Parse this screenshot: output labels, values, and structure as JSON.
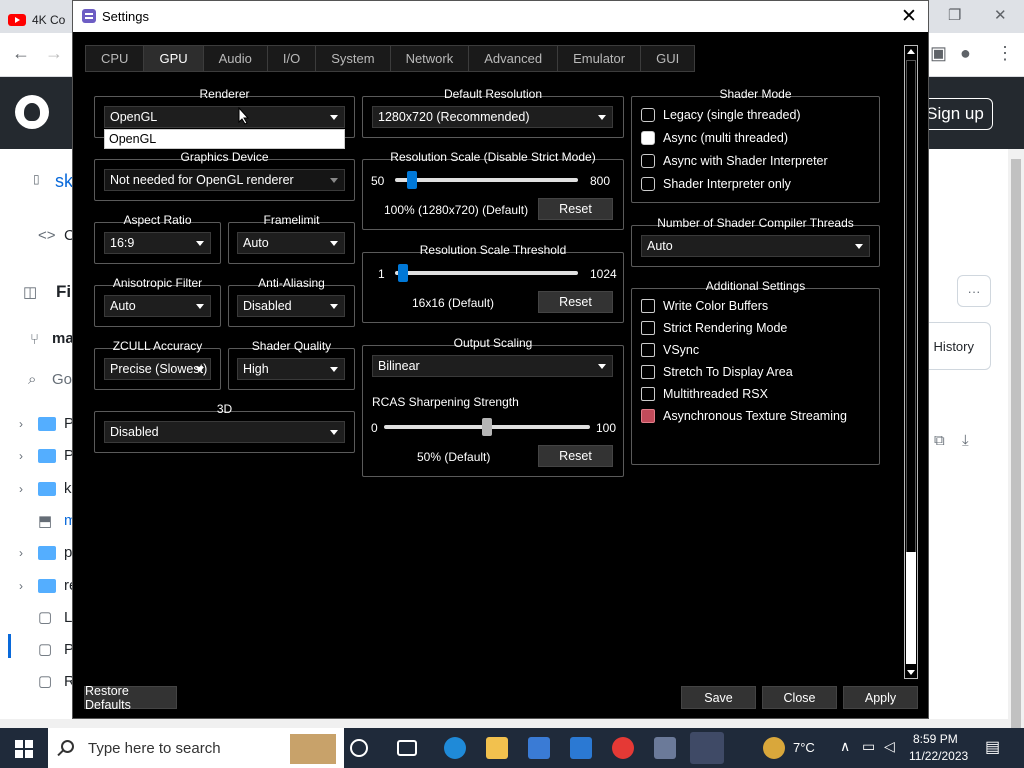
{
  "browser": {
    "tab_title": "4K Co",
    "signup": "Sign up",
    "repo_short": "sk",
    "code_tab": "C",
    "files_label": "Fil",
    "branch": "ma",
    "goto": "Go",
    "history": "History",
    "list_items": [
      "P",
      "P",
      "k",
      "m",
      "p",
      "re",
      "LI",
      "P",
      "R"
    ]
  },
  "dialog": {
    "title": "Settings",
    "tabs": [
      "CPU",
      "GPU",
      "Audio",
      "I/O",
      "System",
      "Network",
      "Advanced",
      "Emulator",
      "GUI"
    ],
    "renderer": {
      "title": "Renderer",
      "value": "OpenGL",
      "popup_item": "OpenGL"
    },
    "graphics_device": {
      "title": "Graphics Device",
      "value": "Not needed for OpenGL renderer"
    },
    "aspect_ratio": {
      "title": "Aspect Ratio",
      "value": "16:9"
    },
    "framelimit": {
      "title": "Framelimit",
      "value": "Auto"
    },
    "anisotropic": {
      "title": "Anisotropic Filter",
      "value": "Auto"
    },
    "anti_aliasing": {
      "title": "Anti-Aliasing",
      "value": "Disabled"
    },
    "zcull": {
      "title": "ZCULL Accuracy",
      "value": "Precise (Slowest)"
    },
    "shader_quality": {
      "title": "Shader Quality",
      "value": "High"
    },
    "three_d": {
      "title": "3D",
      "value": "Disabled"
    },
    "default_resolution": {
      "title": "Default Resolution",
      "value": "1280x720 (Recommended)"
    },
    "resolution_scale": {
      "title": "Resolution Scale (Disable Strict Mode)",
      "min": "50",
      "max": "800",
      "status": "100% (1280x720) (Default)",
      "reset": "Reset",
      "level": 0.067
    },
    "resolution_threshold": {
      "title": "Resolution Scale Threshold",
      "min": "1",
      "max": "1024",
      "status": "16x16 (Default)",
      "reset": "Reset",
      "level": 0.015
    },
    "output_scaling": {
      "title": "Output Scaling",
      "value": "Bilinear",
      "rcas_label": "RCAS Sharpening Strength",
      "min": "0",
      "max": "100",
      "status": "50% (Default)",
      "reset": "Reset",
      "level": 0.5
    },
    "shader_mode": {
      "title": "Shader Mode",
      "options": [
        "Legacy (single threaded)",
        "Async (multi threaded)",
        "Async with Shader Interpreter",
        "Shader Interpreter only"
      ],
      "selected_index": 1
    },
    "compiler_threads": {
      "title": "Number of Shader Compiler Threads",
      "value": "Auto"
    },
    "additional": {
      "title": "Additional Settings",
      "items": [
        "Write Color Buffers",
        "Strict Rendering Mode",
        "VSync",
        "Stretch To Display Area",
        "Multithreaded RSX",
        "Asynchronous Texture Streaming"
      ]
    },
    "buttons": {
      "restore": "Restore Defaults",
      "save": "Save",
      "close": "Close",
      "apply": "Apply"
    }
  },
  "taskbar": {
    "search_placeholder": "Type here to search",
    "weather": "7°C",
    "time": "8:59 PM",
    "date": "11/22/2023"
  }
}
